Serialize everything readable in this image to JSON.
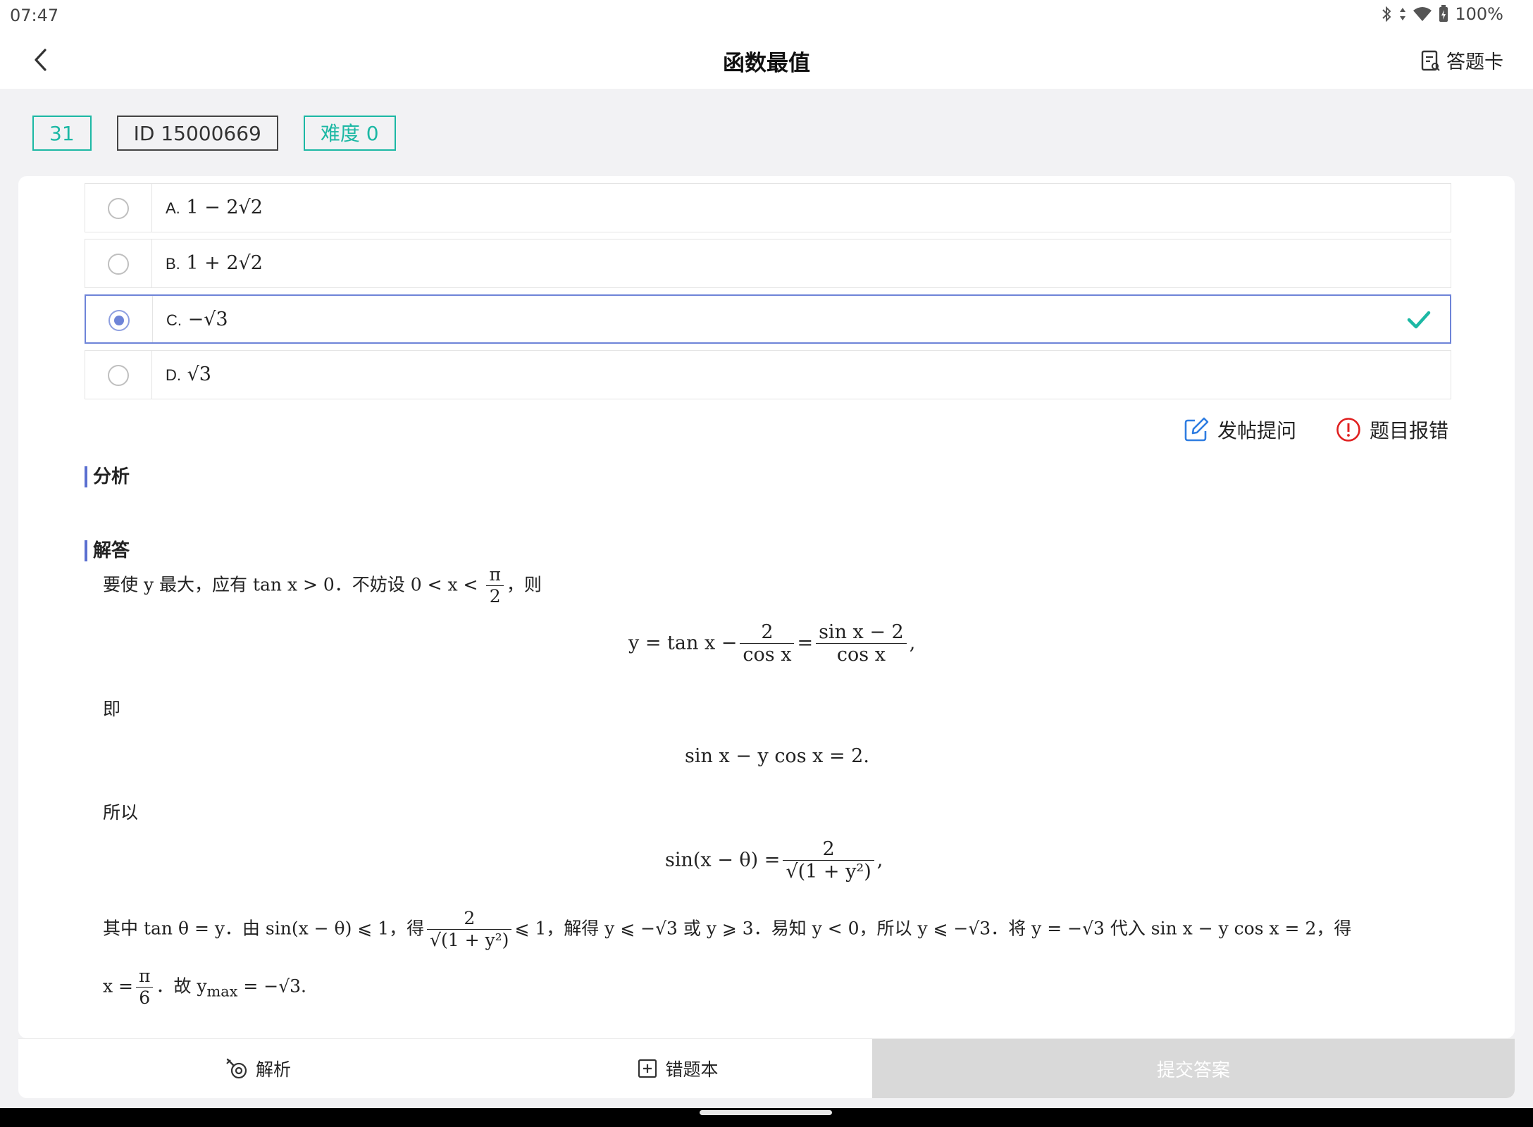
{
  "status": {
    "time": "07:47",
    "battery": "100%"
  },
  "header": {
    "title": "函数最值",
    "answer_card": "答题卡"
  },
  "tags": {
    "number": "31",
    "id": "ID 15000669",
    "difficulty": "难度 0"
  },
  "options": [
    {
      "letter": "A.",
      "expr": "1 − 2√2"
    },
    {
      "letter": "B.",
      "expr": "1 + 2√2"
    },
    {
      "letter": "C.",
      "expr": "−√3",
      "selected": true,
      "correct": true
    },
    {
      "letter": "D.",
      "expr": "√3"
    }
  ],
  "actions": {
    "ask": "发帖提问",
    "report": "题目报错"
  },
  "sections": {
    "analysis": "分析",
    "answer": "解答"
  },
  "solution": {
    "line1_prefix": "要使 y 最大，应有 tan x > 0．不妨设 0 < x < ",
    "line1_frac_num": "π",
    "line1_frac_den": "2",
    "line1_suffix": "，则",
    "eq1_lhs": "y = tan x −",
    "eq1_frac1_num": "2",
    "eq1_frac1_den": "cos x",
    "eq1_mid": "=",
    "eq1_frac2_num": "sin x − 2",
    "eq1_frac2_den": "cos x",
    "eq1_end": ",",
    "ji": "即",
    "eq2": "sin x − y cos x = 2.",
    "suoyi": "所以",
    "eq3_lhs": "sin(x − θ) =",
    "eq3_num": "2",
    "eq3_den": "√(1 + y²)",
    "eq3_end": ",",
    "line2_prefix": "其中 tan θ = y．由 sin(x − θ) ⩽ 1，得",
    "line2_num": "2",
    "line2_den": "√(1 + y²)",
    "line2_suffix": "⩽ 1，解得 y ⩽ −√3 或 y ⩾ 3．易知 y < 0，所以 y ⩽ −√3．将 y = −√3 代入 sin x − y cos x = 2，得",
    "line3_prefix": "x =",
    "line3_num": "π",
    "line3_den": "6",
    "line3_suffix": "．故 y",
    "line3_sub": "max",
    "line3_end": " = −√3."
  },
  "bottom": {
    "analysis": "解析",
    "mistakes": "错题本",
    "submit": "提交答案"
  },
  "colors": {
    "teal": "#1cb8a4",
    "accent": "#6e84d8",
    "report_red": "#e02020",
    "edit_blue": "#2f7de1"
  }
}
